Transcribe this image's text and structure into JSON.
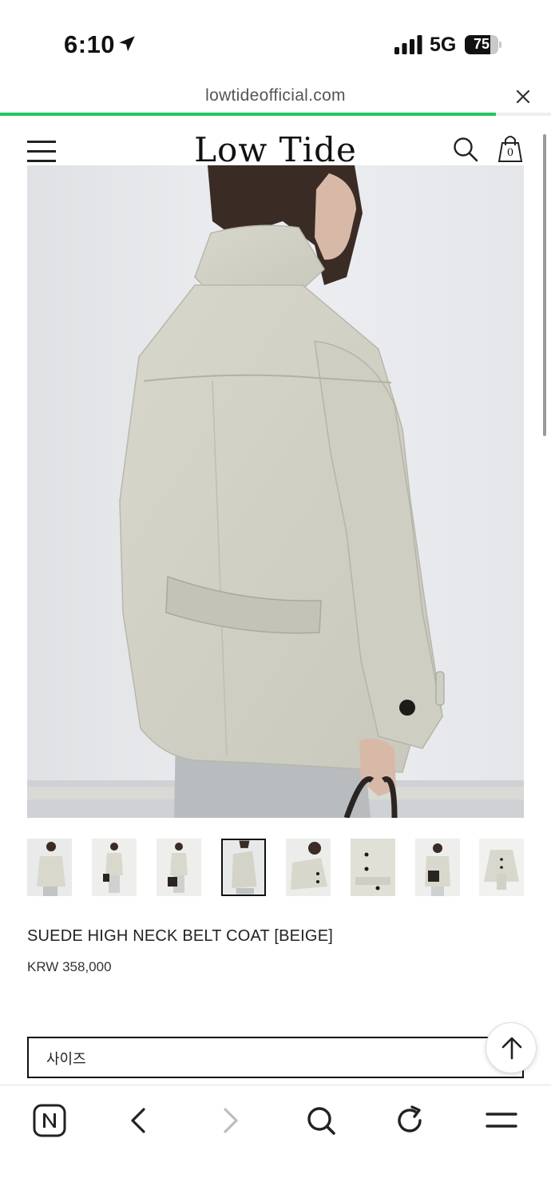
{
  "status_bar": {
    "time": "6:10",
    "network": "5G",
    "battery": "75",
    "battery_level": 0.75,
    "icons": [
      "location-arrow-icon",
      "signal-bars-icon",
      "battery-icon"
    ]
  },
  "browser": {
    "url": "lowtideofficial.com",
    "load_progress": 0.9,
    "accent_color": "#22c55e"
  },
  "header": {
    "brand": "Low Tide",
    "cart_count": "0",
    "icons": [
      "hamburger-menu-icon",
      "search-icon",
      "shopping-bag-icon"
    ]
  },
  "product": {
    "name": "SUEDE HIGH NECK BELT COAT [BEIGE]",
    "price": "KRW 358,000",
    "thumbnail_count": 8,
    "active_thumbnail": 4,
    "size_label": "사이즈"
  },
  "bottom_bar": {
    "icons": [
      "naver-home-icon",
      "back-icon",
      "forward-icon",
      "search-icon",
      "refresh-icon",
      "menu-icon"
    ]
  }
}
